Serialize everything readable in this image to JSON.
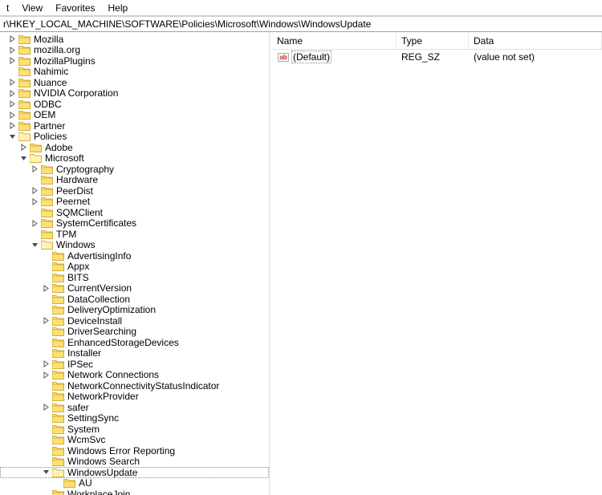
{
  "menu": {
    "items": [
      "t",
      "View",
      "Favorites",
      "Help"
    ]
  },
  "address": "r\\HKEY_LOCAL_MACHINE\\SOFTWARE\\Policies\\Microsoft\\Windows\\WindowsUpdate",
  "list": {
    "headers": {
      "name": "Name",
      "type": "Type",
      "data": "Data"
    },
    "rows": [
      {
        "icon": "ab",
        "name": "(Default)",
        "type": "REG_SZ",
        "data": "(value not set)"
      }
    ]
  },
  "tree": [
    {
      "d": 1,
      "exp": "c",
      "name": "Mozilla"
    },
    {
      "d": 1,
      "exp": "c",
      "name": "mozilla.org"
    },
    {
      "d": 1,
      "exp": "c",
      "name": "MozillaPlugins"
    },
    {
      "d": 1,
      "exp": "",
      "name": "Nahimic"
    },
    {
      "d": 1,
      "exp": "c",
      "name": "Nuance"
    },
    {
      "d": 1,
      "exp": "c",
      "name": "NVIDIA Corporation"
    },
    {
      "d": 1,
      "exp": "c",
      "name": "ODBC"
    },
    {
      "d": 1,
      "exp": "c",
      "name": "OEM"
    },
    {
      "d": 1,
      "exp": "c",
      "name": "Partner"
    },
    {
      "d": 1,
      "exp": "o",
      "name": "Policies"
    },
    {
      "d": 2,
      "exp": "c",
      "name": "Adobe"
    },
    {
      "d": 2,
      "exp": "o",
      "name": "Microsoft"
    },
    {
      "d": 3,
      "exp": "c",
      "name": "Cryptography"
    },
    {
      "d": 3,
      "exp": "",
      "name": "Hardware"
    },
    {
      "d": 3,
      "exp": "c",
      "name": "PeerDist"
    },
    {
      "d": 3,
      "exp": "c",
      "name": "Peernet"
    },
    {
      "d": 3,
      "exp": "",
      "name": "SQMClient"
    },
    {
      "d": 3,
      "exp": "c",
      "name": "SystemCertificates"
    },
    {
      "d": 3,
      "exp": "",
      "name": "TPM"
    },
    {
      "d": 3,
      "exp": "o",
      "name": "Windows"
    },
    {
      "d": 4,
      "exp": "",
      "name": "AdvertisingInfo"
    },
    {
      "d": 4,
      "exp": "",
      "name": "Appx"
    },
    {
      "d": 4,
      "exp": "",
      "name": "BITS"
    },
    {
      "d": 4,
      "exp": "c",
      "name": "CurrentVersion"
    },
    {
      "d": 4,
      "exp": "",
      "name": "DataCollection"
    },
    {
      "d": 4,
      "exp": "",
      "name": "DeliveryOptimization"
    },
    {
      "d": 4,
      "exp": "c",
      "name": "DeviceInstall"
    },
    {
      "d": 4,
      "exp": "",
      "name": "DriverSearching"
    },
    {
      "d": 4,
      "exp": "",
      "name": "EnhancedStorageDevices"
    },
    {
      "d": 4,
      "exp": "",
      "name": "Installer"
    },
    {
      "d": 4,
      "exp": "c",
      "name": "IPSec"
    },
    {
      "d": 4,
      "exp": "c",
      "name": "Network Connections"
    },
    {
      "d": 4,
      "exp": "",
      "name": "NetworkConnectivityStatusIndicator"
    },
    {
      "d": 4,
      "exp": "",
      "name": "NetworkProvider"
    },
    {
      "d": 4,
      "exp": "c",
      "name": "safer"
    },
    {
      "d": 4,
      "exp": "",
      "name": "SettingSync"
    },
    {
      "d": 4,
      "exp": "",
      "name": "System"
    },
    {
      "d": 4,
      "exp": "",
      "name": "WcmSvc"
    },
    {
      "d": 4,
      "exp": "",
      "name": "Windows Error Reporting"
    },
    {
      "d": 4,
      "exp": "",
      "name": "Windows Search"
    },
    {
      "d": 4,
      "exp": "o",
      "name": "WindowsUpdate",
      "sel": true
    },
    {
      "d": 5,
      "exp": "",
      "name": "AU"
    },
    {
      "d": 4,
      "exp": "",
      "name": "WorkplaceJoin"
    }
  ],
  "icons": {
    "string_badge": "ab"
  }
}
